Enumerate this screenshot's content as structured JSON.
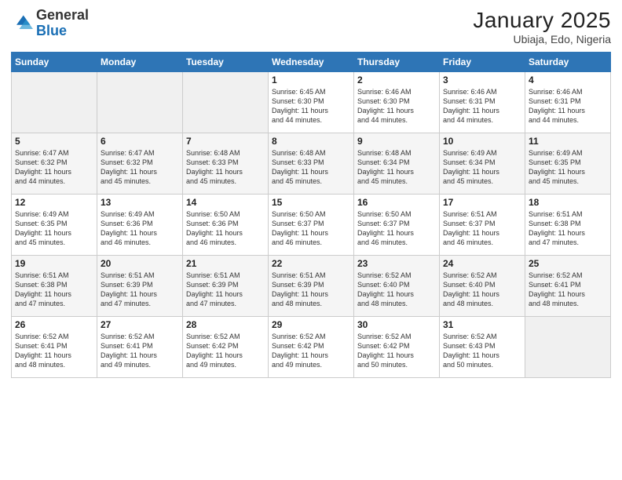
{
  "logo": {
    "line1": "General",
    "line2": "Blue"
  },
  "header": {
    "month": "January 2025",
    "location": "Ubiaja, Edo, Nigeria"
  },
  "weekdays": [
    "Sunday",
    "Monday",
    "Tuesday",
    "Wednesday",
    "Thursday",
    "Friday",
    "Saturday"
  ],
  "weeks": [
    [
      {
        "day": "",
        "info": ""
      },
      {
        "day": "",
        "info": ""
      },
      {
        "day": "",
        "info": ""
      },
      {
        "day": "1",
        "info": "Sunrise: 6:45 AM\nSunset: 6:30 PM\nDaylight: 11 hours\nand 44 minutes."
      },
      {
        "day": "2",
        "info": "Sunrise: 6:46 AM\nSunset: 6:30 PM\nDaylight: 11 hours\nand 44 minutes."
      },
      {
        "day": "3",
        "info": "Sunrise: 6:46 AM\nSunset: 6:31 PM\nDaylight: 11 hours\nand 44 minutes."
      },
      {
        "day": "4",
        "info": "Sunrise: 6:46 AM\nSunset: 6:31 PM\nDaylight: 11 hours\nand 44 minutes."
      }
    ],
    [
      {
        "day": "5",
        "info": "Sunrise: 6:47 AM\nSunset: 6:32 PM\nDaylight: 11 hours\nand 44 minutes."
      },
      {
        "day": "6",
        "info": "Sunrise: 6:47 AM\nSunset: 6:32 PM\nDaylight: 11 hours\nand 45 minutes."
      },
      {
        "day": "7",
        "info": "Sunrise: 6:48 AM\nSunset: 6:33 PM\nDaylight: 11 hours\nand 45 minutes."
      },
      {
        "day": "8",
        "info": "Sunrise: 6:48 AM\nSunset: 6:33 PM\nDaylight: 11 hours\nand 45 minutes."
      },
      {
        "day": "9",
        "info": "Sunrise: 6:48 AM\nSunset: 6:34 PM\nDaylight: 11 hours\nand 45 minutes."
      },
      {
        "day": "10",
        "info": "Sunrise: 6:49 AM\nSunset: 6:34 PM\nDaylight: 11 hours\nand 45 minutes."
      },
      {
        "day": "11",
        "info": "Sunrise: 6:49 AM\nSunset: 6:35 PM\nDaylight: 11 hours\nand 45 minutes."
      }
    ],
    [
      {
        "day": "12",
        "info": "Sunrise: 6:49 AM\nSunset: 6:35 PM\nDaylight: 11 hours\nand 45 minutes."
      },
      {
        "day": "13",
        "info": "Sunrise: 6:49 AM\nSunset: 6:36 PM\nDaylight: 11 hours\nand 46 minutes."
      },
      {
        "day": "14",
        "info": "Sunrise: 6:50 AM\nSunset: 6:36 PM\nDaylight: 11 hours\nand 46 minutes."
      },
      {
        "day": "15",
        "info": "Sunrise: 6:50 AM\nSunset: 6:37 PM\nDaylight: 11 hours\nand 46 minutes."
      },
      {
        "day": "16",
        "info": "Sunrise: 6:50 AM\nSunset: 6:37 PM\nDaylight: 11 hours\nand 46 minutes."
      },
      {
        "day": "17",
        "info": "Sunrise: 6:51 AM\nSunset: 6:37 PM\nDaylight: 11 hours\nand 46 minutes."
      },
      {
        "day": "18",
        "info": "Sunrise: 6:51 AM\nSunset: 6:38 PM\nDaylight: 11 hours\nand 47 minutes."
      }
    ],
    [
      {
        "day": "19",
        "info": "Sunrise: 6:51 AM\nSunset: 6:38 PM\nDaylight: 11 hours\nand 47 minutes."
      },
      {
        "day": "20",
        "info": "Sunrise: 6:51 AM\nSunset: 6:39 PM\nDaylight: 11 hours\nand 47 minutes."
      },
      {
        "day": "21",
        "info": "Sunrise: 6:51 AM\nSunset: 6:39 PM\nDaylight: 11 hours\nand 47 minutes."
      },
      {
        "day": "22",
        "info": "Sunrise: 6:51 AM\nSunset: 6:39 PM\nDaylight: 11 hours\nand 48 minutes."
      },
      {
        "day": "23",
        "info": "Sunrise: 6:52 AM\nSunset: 6:40 PM\nDaylight: 11 hours\nand 48 minutes."
      },
      {
        "day": "24",
        "info": "Sunrise: 6:52 AM\nSunset: 6:40 PM\nDaylight: 11 hours\nand 48 minutes."
      },
      {
        "day": "25",
        "info": "Sunrise: 6:52 AM\nSunset: 6:41 PM\nDaylight: 11 hours\nand 48 minutes."
      }
    ],
    [
      {
        "day": "26",
        "info": "Sunrise: 6:52 AM\nSunset: 6:41 PM\nDaylight: 11 hours\nand 48 minutes."
      },
      {
        "day": "27",
        "info": "Sunrise: 6:52 AM\nSunset: 6:41 PM\nDaylight: 11 hours\nand 49 minutes."
      },
      {
        "day": "28",
        "info": "Sunrise: 6:52 AM\nSunset: 6:42 PM\nDaylight: 11 hours\nand 49 minutes."
      },
      {
        "day": "29",
        "info": "Sunrise: 6:52 AM\nSunset: 6:42 PM\nDaylight: 11 hours\nand 49 minutes."
      },
      {
        "day": "30",
        "info": "Sunrise: 6:52 AM\nSunset: 6:42 PM\nDaylight: 11 hours\nand 50 minutes."
      },
      {
        "day": "31",
        "info": "Sunrise: 6:52 AM\nSunset: 6:43 PM\nDaylight: 11 hours\nand 50 minutes."
      },
      {
        "day": "",
        "info": ""
      }
    ]
  ]
}
